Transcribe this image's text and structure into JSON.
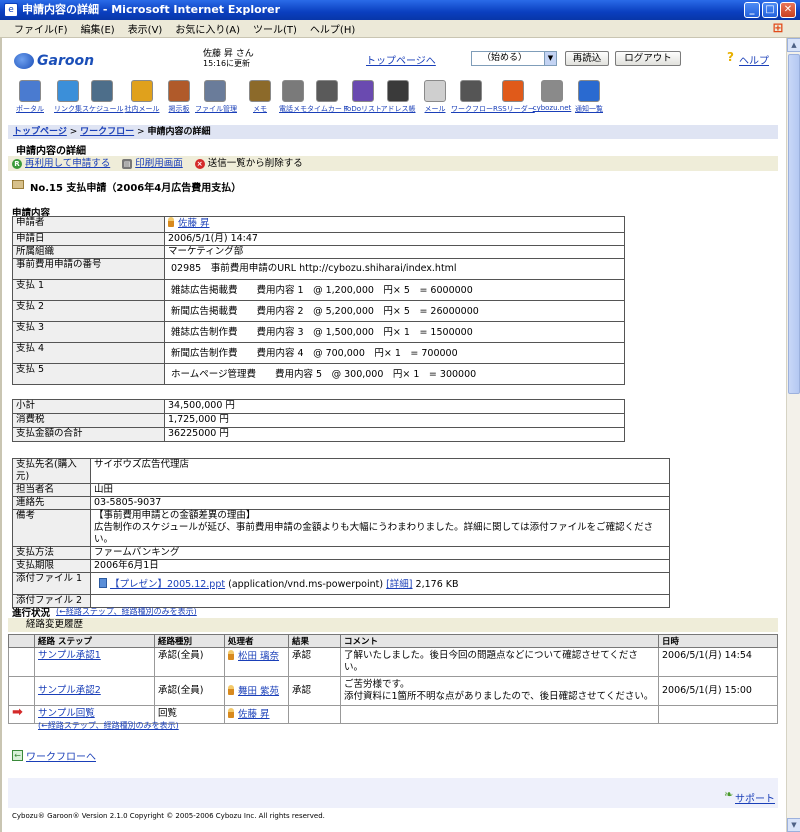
{
  "window": {
    "title": "申請内容の詳細 - Microsoft Internet Explorer",
    "min": "_",
    "max": "□",
    "close": "✕"
  },
  "menubar": [
    "ファイル(F)",
    "編集(E)",
    "表示(V)",
    "お気に入り(A)",
    "ツール(T)",
    "ヘルプ(H)"
  ],
  "header": {
    "logo_text": "Garoon",
    "user_name": "佐藤 昇 さん",
    "update_time": "15:16に更新",
    "top_link": "トップページへ",
    "start_select": "（始める）",
    "reload": "再読込",
    "logout": "ログアウト",
    "help": "ヘルプ"
  },
  "apps": [
    {
      "label": "ポータル",
      "color": "#4a7bd0"
    },
    {
      "label": "リンク集",
      "color": "#3b8fd9"
    },
    {
      "label": "スケジュール",
      "color": "#4d6e8a"
    },
    {
      "label": "社内メール",
      "color": "#e0a11c"
    },
    {
      "label": "掲示板",
      "color": "#b05a2a"
    },
    {
      "label": "ファイル管理",
      "color": "#6a7c9a"
    },
    {
      "label": "メモ",
      "color": "#8c6a2a"
    },
    {
      "label": "電話メモ",
      "color": "#7a7a7a"
    },
    {
      "label": "タイムカード",
      "color": "#5a5a5a"
    },
    {
      "label": "ToDoリスト",
      "color": "#6a4ab0"
    },
    {
      "label": "アドレス帳",
      "color": "#3a3a3a"
    },
    {
      "label": "メール",
      "color": "#cfcfcf"
    },
    {
      "label": "ワークフロー",
      "color": "#555555"
    },
    {
      "label": "RSSリーダー",
      "color": "#e05a1a"
    },
    {
      "label": "cybozu.net",
      "color": "#8a8a8a"
    },
    {
      "label": "通知一覧",
      "color": "#2a6ad0"
    }
  ],
  "breadcrumb": {
    "home": "トップページ",
    "sep": ">",
    "workflow": "ワークフロー",
    "current": "申請内容の詳細"
  },
  "page_title": "申請内容の詳細",
  "actions": {
    "reuse": "再利用して申請する",
    "print": "印刷用画面",
    "delete": "送信一覧から削除する"
  },
  "request_heading": "No.15 支払申請（2006年4月広告費用支払）",
  "section_content": "申請内容",
  "details": {
    "applicant_label": "申請者",
    "applicant": "佐藤 昇",
    "date_label": "申請日",
    "date": "2006/5/1(月) 14:47",
    "org_label": "所属組織",
    "org": "マーケティング部",
    "number_label": "事前費用申請の番号",
    "number": "02985　事前費用申請のURL  http://cybozu.shiharai/index.html",
    "pay1_label": "支払 1",
    "pay1": "雑誌広告掲載費　　費用内容 1　@ 1,200,000　円×  5　= 6000000",
    "pay2_label": "支払 2",
    "pay2": "新聞広告掲載費　　費用内容 2　@ 5,200,000　円×  5　= 26000000",
    "pay3_label": "支払 3",
    "pay3": "雑誌広告制作費　　費用内容 3　@ 1,500,000　円×  1　= 1500000",
    "pay4_label": "支払 4",
    "pay4": "新聞広告制作費　　費用内容 4　@  700,000　円×  1　=  700000",
    "pay5_label": "支払 5",
    "pay5": "ホームページ管理費　　費用内容 5　@  300,000　円×  1　=  300000"
  },
  "totals": {
    "subtotal_label": "小計",
    "subtotal": "34,500,000 円",
    "tax_label": "消費税",
    "tax": "1,725,000 円",
    "total_label": "支払金額の合計",
    "total": "36225000 円"
  },
  "payee": {
    "to_label": "支払先名(購入元)",
    "to": "サイボウズ広告代理店",
    "person_label": "担当者名",
    "person": "山田",
    "contact_label": "連絡先",
    "contact": "03-5805-9037",
    "note_label": "備考",
    "note1": "【事前費用申請との金額差異の理由】",
    "note2": "広告制作のスケジュールが延び、事前費用申請の金額よりも大幅にうわまわりました。詳細に関しては添付ファイルをご確認ください。",
    "method_label": "支払方法",
    "method": "ファームバンキング",
    "due_label": "支払期限",
    "due": "2006年6月1日",
    "att1_label": "添付ファイル 1",
    "att1_name": "【プレゼン】2005.12.ppt",
    "att1_type": "(application/vnd.ms-powerpoint)",
    "att1_detail": "[詳細]",
    "att1_size": "2,176 KB",
    "att2_label": "添付ファイル 2",
    "att2": ""
  },
  "progress": {
    "heading": "進行状況",
    "hint": "(←経路ステップ、経路種別のみを表示)",
    "history": "経路変更履歴",
    "headers": [
      "",
      "経路 ステップ",
      "経路種別",
      "処理者",
      "結果",
      "コメント",
      "日時"
    ],
    "rows": [
      {
        "step": "サンプル承認1",
        "type": "承認(全員)",
        "person": "松田 璃奈",
        "result": "承認",
        "comment": "了解いたしました。後日今回の問題点などについて確認させてください。",
        "comment2": "",
        "time": "2006/5/1(月) 14:54"
      },
      {
        "step": "サンプル承認2",
        "type": "承認(全員)",
        "person": "舞田 紫苑",
        "result": "承認",
        "comment": "ご苦労様です。",
        "comment2": "添付資料に1箇所不明な点がありましたので、後日確認させてください。",
        "time": "2006/5/1(月) 15:00"
      },
      {
        "step": "サンプル回覧",
        "type": "回覧",
        "person": "佐藤 昇",
        "result": "",
        "comment": "",
        "comment2": "",
        "time": ""
      }
    ],
    "hint2": "(←経路ステップ、経路種別のみを表示)"
  },
  "back_link": "ワークフローへ",
  "support": "サポート",
  "copyright": "Cybozu® Garoon® Version 2.1.0    Copyright © 2005-2006 Cybozu Inc. All rights reserved."
}
